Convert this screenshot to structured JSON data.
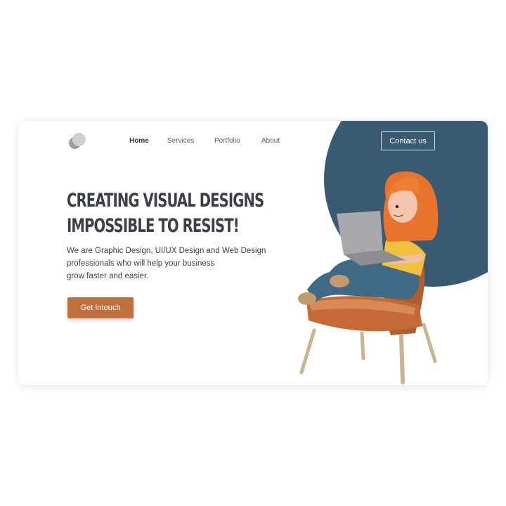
{
  "nav": {
    "items": [
      {
        "label": "Home",
        "active": true
      },
      {
        "label": "Services",
        "active": false
      },
      {
        "label": "Portfolio",
        "active": false
      },
      {
        "label": "About",
        "active": false
      }
    ],
    "contact_label": "Contact us"
  },
  "hero": {
    "headline_line1": "CREATING VISUAL DESIGNS",
    "headline_line2": "IMPOSSIBLE TO RESIST!",
    "description_lines": [
      "We are Graphic Design, UI/UX Design and Web Design",
      "professionals who will help your business",
      "grow faster and easier."
    ],
    "cta_label": "Get Intouch"
  },
  "colors": {
    "accent": "#c0703c",
    "blob": "#3a5a72",
    "text_dark": "#3b4048"
  },
  "icons": {
    "logo": "two-circles-logo",
    "illustration": "girl-with-laptop-on-armchair"
  }
}
